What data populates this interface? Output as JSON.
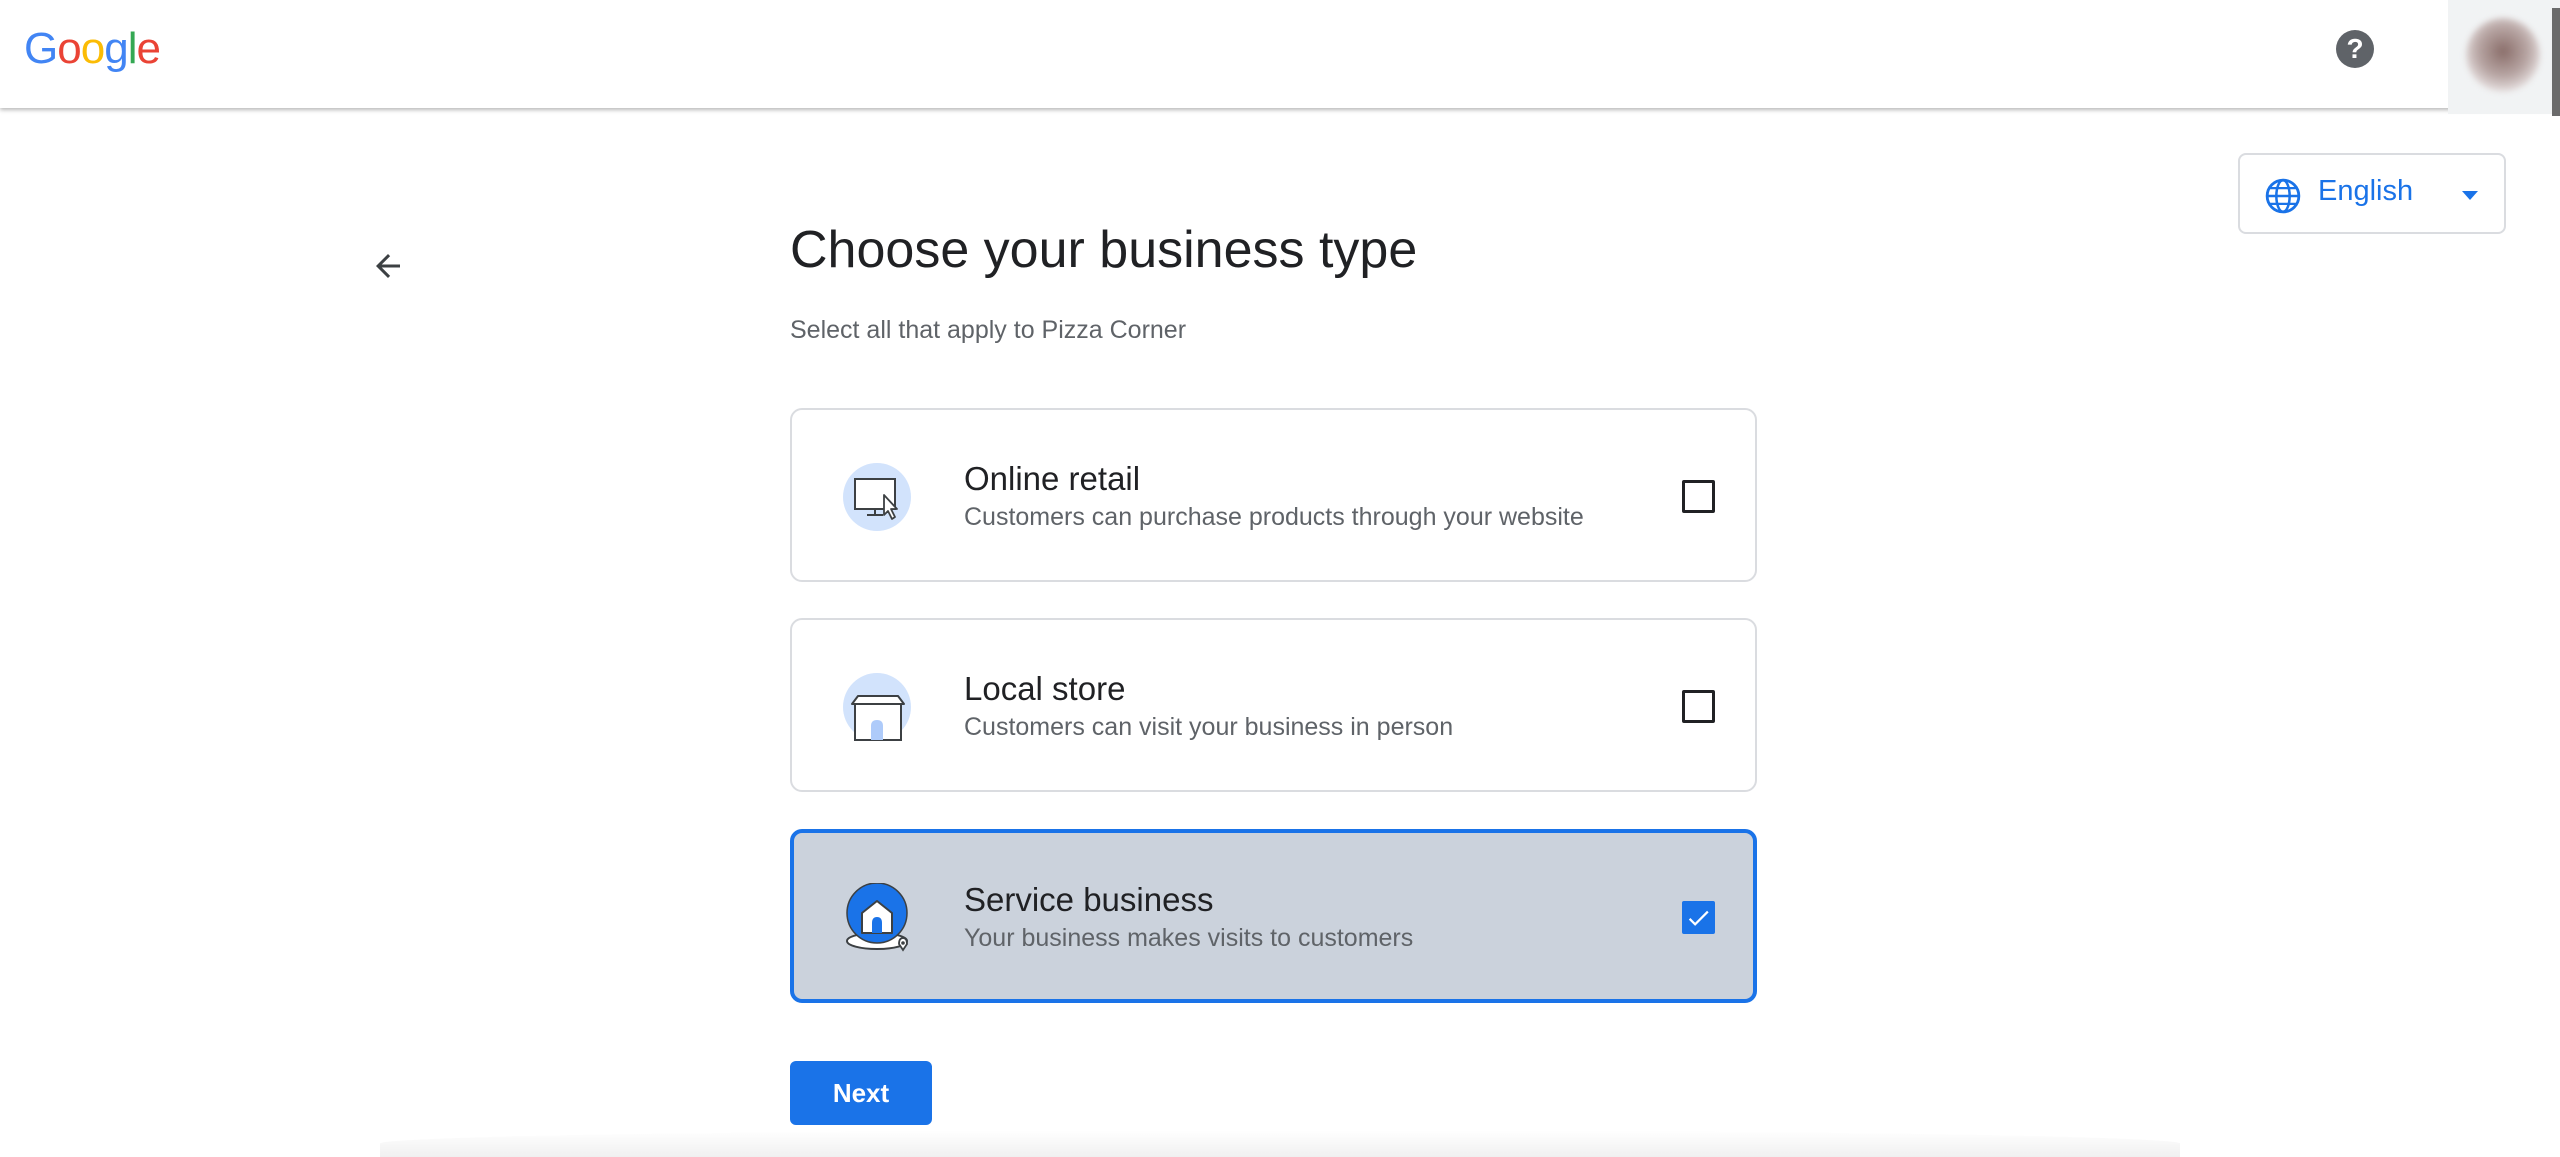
{
  "header": {
    "logo": {
      "letters": [
        "G",
        "o",
        "o",
        "g",
        "l",
        "e"
      ],
      "colors": [
        "#4285F4",
        "#EA4335",
        "#FBBC05",
        "#4285F4",
        "#34A853",
        "#EA4335"
      ]
    },
    "help_glyph": "?",
    "help_icon": "help-circle-icon",
    "avatar_icon": "account-avatar"
  },
  "language": {
    "label": "English",
    "icon": "globe-icon",
    "accent": "#1a73e8"
  },
  "page": {
    "title": "Choose your business type",
    "subtitle": "Select all that apply to Pizza Corner"
  },
  "options": [
    {
      "title": "Online retail",
      "description": "Customers can purchase products through your website",
      "checked": false,
      "icon": "online-retail-icon"
    },
    {
      "title": "Local store",
      "description": "Customers can visit your business in person",
      "checked": false,
      "icon": "local-store-icon"
    },
    {
      "title": "Service business",
      "description": "Your business makes visits to customers",
      "checked": true,
      "icon": "service-business-icon"
    }
  ],
  "actions": {
    "next_label": "Next"
  },
  "colors": {
    "primary": "#1a73e8",
    "selected_bg": "#cbd2dc",
    "border": "#dadce0",
    "text": "#202124",
    "secondary_text": "#5f6368"
  }
}
